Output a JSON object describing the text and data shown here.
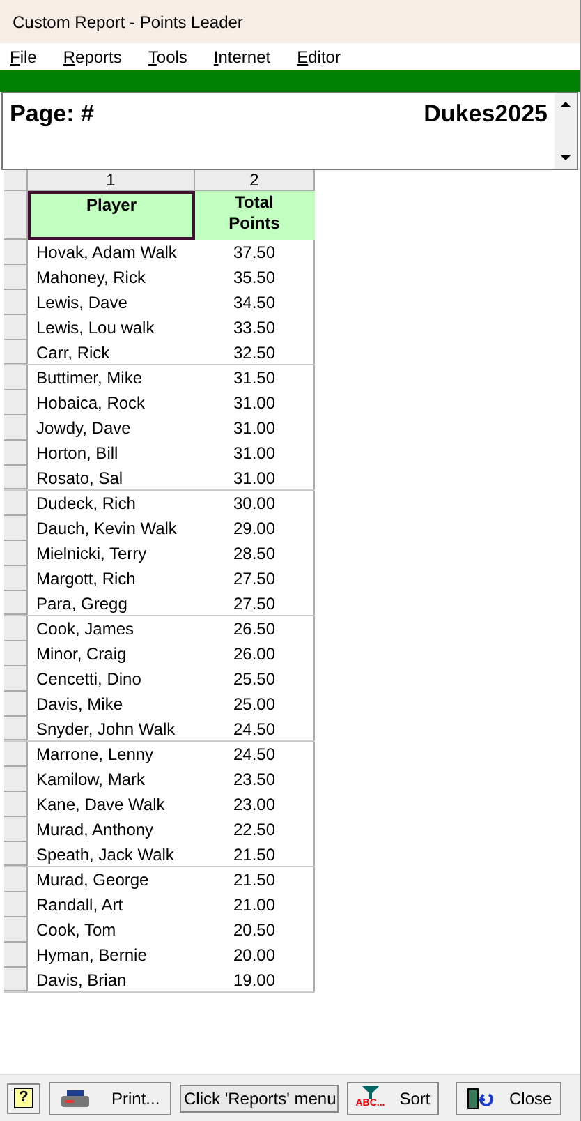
{
  "window": {
    "title": "Custom Report - Points Leader"
  },
  "menu": [
    "File",
    "Reports",
    "Tools",
    "Internet",
    "Editor"
  ],
  "report_header": {
    "page_label": "Page: #",
    "club_name": "Dukes2025"
  },
  "table": {
    "column_numbers": [
      "1",
      "2"
    ],
    "columns": [
      {
        "label": "Player",
        "selected": true
      },
      {
        "label": "Total Points",
        "selected": false
      }
    ],
    "rows": [
      [
        "Hovak, Adam Walk",
        "37.50"
      ],
      [
        "Mahoney, Rick",
        "35.50"
      ],
      [
        "Lewis, Dave",
        "34.50"
      ],
      [
        "Lewis, Lou walk",
        "33.50"
      ],
      [
        "Carr, Rick",
        "32.50"
      ],
      [
        "Buttimer, Mike",
        "31.50"
      ],
      [
        "Hobaica, Rock",
        "31.00"
      ],
      [
        "Jowdy, Dave",
        "31.00"
      ],
      [
        "Horton, Bill",
        "31.00"
      ],
      [
        "Rosato, Sal",
        "31.00"
      ],
      [
        "Dudeck, Rich",
        "30.00"
      ],
      [
        "Dauch, Kevin Walk",
        "29.00"
      ],
      [
        "Mielnicki, Terry",
        "28.50"
      ],
      [
        "Margott, Rich",
        "27.50"
      ],
      [
        "Para, Gregg",
        "27.50"
      ],
      [
        "Cook, James",
        "26.50"
      ],
      [
        "Minor, Craig",
        "26.00"
      ],
      [
        "Cencetti, Dino",
        "25.50"
      ],
      [
        "Davis, Mike",
        "25.00"
      ],
      [
        "Snyder, John Walk",
        "24.50"
      ],
      [
        "Marrone, Lenny",
        "24.50"
      ],
      [
        "Kamilow, Mark",
        "23.50"
      ],
      [
        "Kane, Dave Walk",
        "23.00"
      ],
      [
        "Murad, Anthony",
        "22.50"
      ],
      [
        "Speath, Jack Walk",
        "21.50"
      ],
      [
        "Murad, George",
        "21.50"
      ],
      [
        "Randall, Art",
        "21.00"
      ],
      [
        "Cook, Tom",
        "20.50"
      ],
      [
        "Hyman, Bernie",
        "20.00"
      ],
      [
        "Davis, Brian",
        "19.00"
      ]
    ]
  },
  "toolbar": {
    "help": "?",
    "print": "Print...",
    "status": "Click 'Reports' menu",
    "sort_icon_text": "ABC...",
    "sort": "Sort",
    "close": "Close"
  }
}
